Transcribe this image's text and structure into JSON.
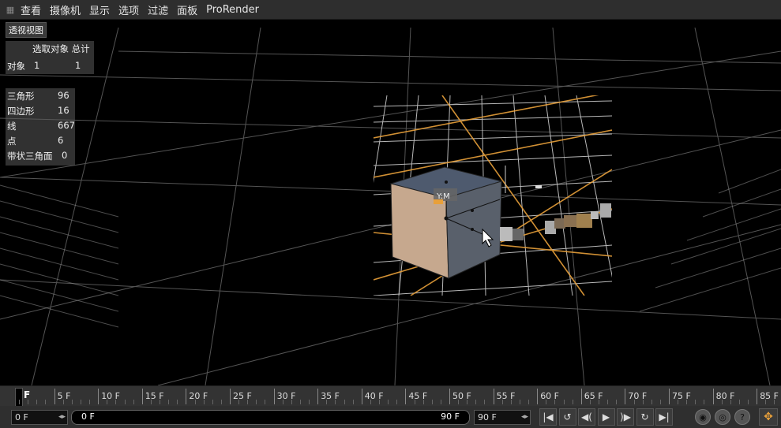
{
  "menu": {
    "items": [
      "查看",
      "摄像机",
      "显示",
      "选项",
      "过滤",
      "面板",
      "ProRender"
    ]
  },
  "viewport": {
    "label": "透视视图",
    "axis_label": "Y:M",
    "hud_objects": {
      "header": "选取对象 总计",
      "label": "对象",
      "selected": "1",
      "total": "1"
    },
    "hud_stats": [
      {
        "k": "三角形",
        "v": "96"
      },
      {
        "k": "四边形",
        "v": "16"
      },
      {
        "k": "线",
        "v": "667"
      },
      {
        "k": "点",
        "v": "6"
      },
      {
        "k": "带状三角面",
        "v": "0"
      }
    ]
  },
  "timeline": {
    "start_label": "F",
    "ticks": [
      "5 F",
      "10 F",
      "15 F",
      "20 F",
      "25 F",
      "30 F",
      "35 F",
      "40 F",
      "45 F",
      "50 F",
      "55 F",
      "60 F",
      "65 F",
      "70 F",
      "75 F",
      "80 F",
      "85 F"
    ]
  },
  "controls": {
    "start_field": "0 F",
    "range_start": "0 F",
    "range_end": "90 F",
    "end_field": "90 F",
    "buttons": [
      {
        "name": "go-to-start-button",
        "icon": "skip-start-icon",
        "glyph": "|◀"
      },
      {
        "name": "previous-key-button",
        "icon": "prev-key-icon",
        "glyph": "↺"
      },
      {
        "name": "previous-frame-button",
        "icon": "prev-frame-icon",
        "glyph": "◀("
      },
      {
        "name": "play-button",
        "icon": "play-icon",
        "glyph": "▶"
      },
      {
        "name": "next-frame-button",
        "icon": "next-frame-icon",
        "glyph": ")▶"
      },
      {
        "name": "next-key-button",
        "icon": "next-key-icon",
        "glyph": "↻"
      },
      {
        "name": "go-to-end-button",
        "icon": "skip-end-icon",
        "glyph": "▶|"
      }
    ],
    "record_buttons": [
      {
        "name": "record-button",
        "icon": "record-icon",
        "glyph": "◉"
      },
      {
        "name": "auto-key-button",
        "icon": "auto-key-icon",
        "glyph": "◎"
      },
      {
        "name": "key-help-button",
        "icon": "help-icon",
        "glyph": "?"
      }
    ],
    "accent": "#e8a03a"
  }
}
